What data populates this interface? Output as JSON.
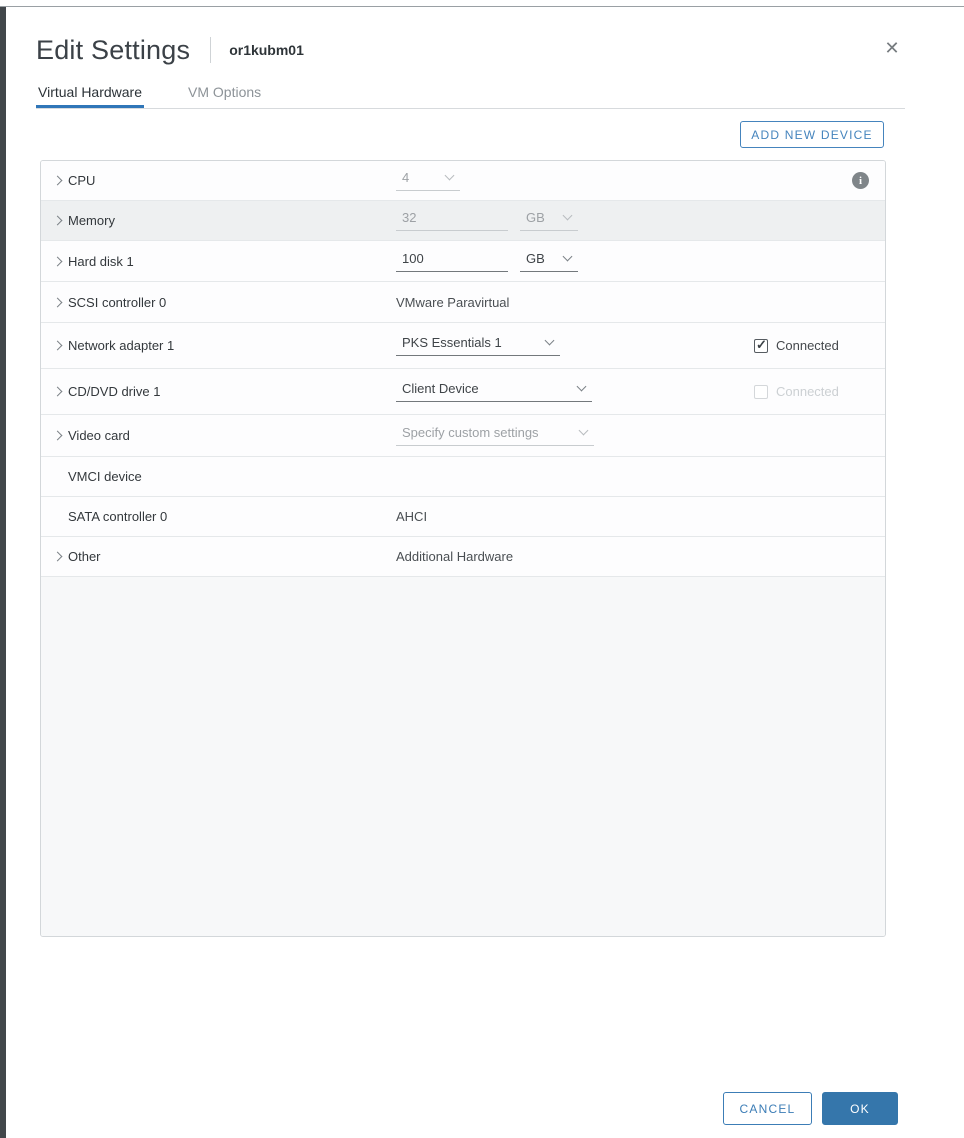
{
  "dialog": {
    "title": "Edit Settings",
    "vm_name": "or1kubm01",
    "close_icon": "✕"
  },
  "tabs": [
    {
      "label": "Virtual Hardware",
      "active": true
    },
    {
      "label": "VM Options",
      "active": false
    }
  ],
  "toolbar": {
    "add_new_device_label": "ADD NEW DEVICE"
  },
  "icons": {
    "info": "i",
    "chevron_down": "v",
    "chevron_right": ">",
    "check": "✓"
  },
  "hardware": {
    "rows": [
      {
        "label": "CPU",
        "control": "select",
        "value": "4",
        "disabled": true,
        "has_info": true
      },
      {
        "label": "Memory",
        "control": "input-unit",
        "value": "32",
        "unit": "GB",
        "disabled": true,
        "highlighted": true
      },
      {
        "label": "Hard disk 1",
        "control": "input-unit",
        "value": "100",
        "unit": "GB",
        "disabled": false
      },
      {
        "label": "SCSI controller 0",
        "control": "text",
        "value": "VMware Paravirtual"
      },
      {
        "label": "Network adapter 1",
        "control": "select",
        "value": "PKS Essentials 1",
        "checkbox": {
          "label": "Connected",
          "checked": true,
          "disabled": false
        }
      },
      {
        "label": "CD/DVD drive 1",
        "control": "select",
        "value": "Client Device",
        "checkbox": {
          "label": "Connected",
          "checked": false,
          "disabled": true
        }
      },
      {
        "label": "Video card",
        "control": "select",
        "value": "Specify custom settings",
        "disabled": true
      },
      {
        "label": "VMCI device",
        "control": "none",
        "value": ""
      },
      {
        "label": "SATA controller 0",
        "control": "text",
        "value": "AHCI"
      },
      {
        "label": "Other",
        "control": "text",
        "value": "Additional Hardware"
      }
    ]
  },
  "footer": {
    "cancel_label": "CANCEL",
    "ok_label": "OK"
  },
  "colors": {
    "accent_blue": "#3576ab",
    "tab_underline": "#3076b8",
    "outline_blue": "#4584bd"
  }
}
